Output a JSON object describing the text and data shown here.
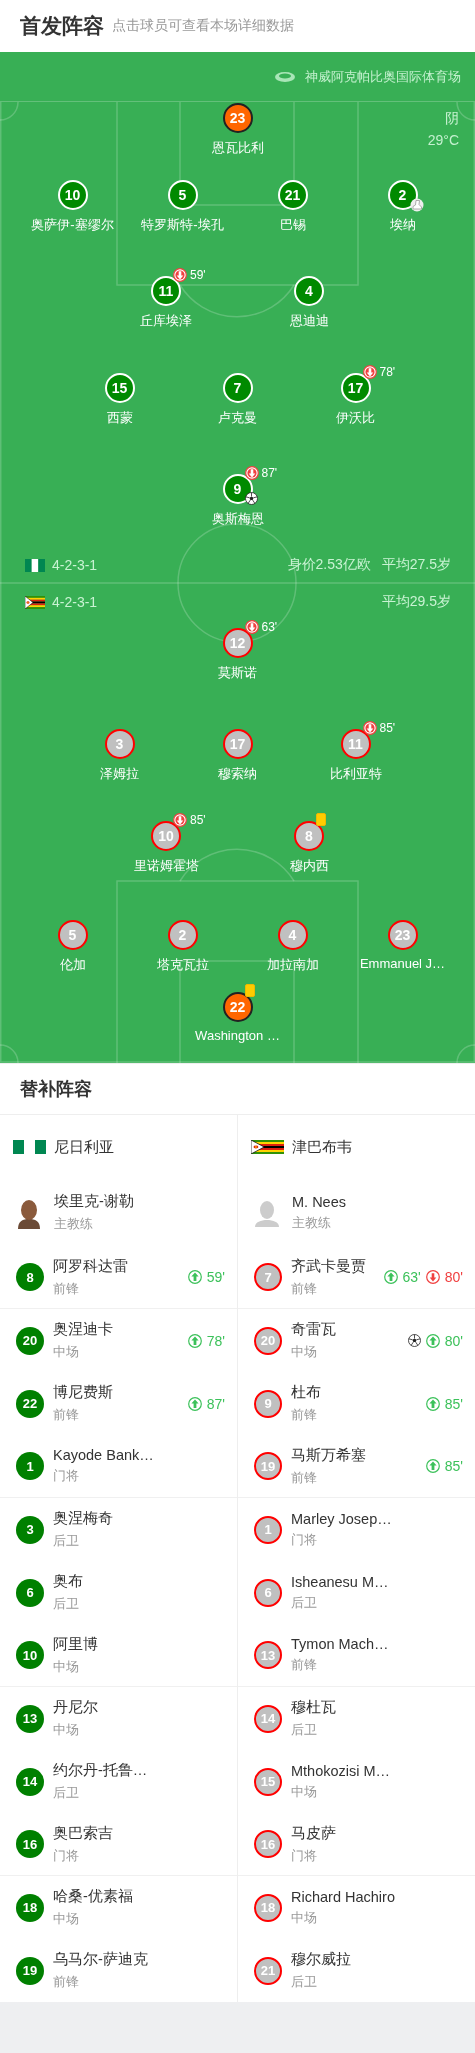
{
  "header": {
    "title": "首发阵容",
    "hint": "点击球员可查看本场详细数据"
  },
  "venue": {
    "stadium": "神威阿克帕比奥国际体育场",
    "weather": "阴",
    "temperature": "29°C"
  },
  "home": {
    "formation": "4-2-3-1",
    "value": "身价2.53亿欧",
    "average_age": "平均27.5岁",
    "lines": [
      [
        {
          "number": "23",
          "name": "恩瓦比利",
          "kind": "goalkeeper"
        }
      ],
      [
        {
          "number": "10",
          "name": "奥萨伊-塞缪尔",
          "kind": "outfield"
        },
        {
          "number": "5",
          "name": "特罗斯特-埃孔",
          "kind": "outfield"
        },
        {
          "number": "21",
          "name": "巴锡",
          "kind": "outfield"
        },
        {
          "number": "2",
          "name": "埃纳",
          "kind": "outfield",
          "events": [
            {
              "kind": "assist"
            }
          ]
        }
      ],
      [
        {
          "number": "11",
          "name": "丘库埃泽",
          "kind": "outfield",
          "events": [
            {
              "kind": "sub_off",
              "minute": "59'"
            }
          ]
        },
        {
          "number": "4",
          "name": "恩迪迪",
          "kind": "outfield"
        }
      ],
      [
        {
          "number": "15",
          "name": "西蒙",
          "kind": "outfield"
        },
        {
          "number": "7",
          "name": "卢克曼",
          "kind": "outfield"
        },
        {
          "number": "17",
          "name": "伊沃比",
          "kind": "outfield",
          "events": [
            {
              "kind": "sub_off",
              "minute": "78'"
            }
          ]
        }
      ],
      [
        {
          "number": "9",
          "name": "奥斯梅恩",
          "kind": "outfield",
          "events": [
            {
              "kind": "sub_off",
              "minute": "87'"
            },
            {
              "kind": "goal"
            }
          ]
        }
      ]
    ]
  },
  "away": {
    "formation": "4-2-3-1",
    "average_age": "平均29.5岁",
    "lines": [
      [
        {
          "number": "12",
          "name": "莫斯诺",
          "kind": "outfield",
          "events": [
            {
              "kind": "sub_off",
              "minute": "63'"
            }
          ]
        }
      ],
      [
        {
          "number": "3",
          "name": "泽姆拉",
          "kind": "outfield"
        },
        {
          "number": "17",
          "name": "穆索纳",
          "kind": "outfield"
        },
        {
          "number": "11",
          "name": "比利亚特",
          "kind": "outfield",
          "events": [
            {
              "kind": "sub_off",
              "minute": "85'"
            }
          ]
        }
      ],
      [
        {
          "number": "10",
          "name": "里诺姆霍塔",
          "kind": "outfield",
          "events": [
            {
              "kind": "sub_off",
              "minute": "85'"
            }
          ]
        },
        {
          "number": "8",
          "name": "穆内西",
          "kind": "outfield",
          "events": [
            {
              "kind": "yellow_card"
            }
          ]
        }
      ],
      [
        {
          "number": "5",
          "name": "伦加",
          "kind": "outfield"
        },
        {
          "number": "2",
          "name": "塔克瓦拉",
          "kind": "outfield"
        },
        {
          "number": "4",
          "name": "加拉南加",
          "kind": "outfield"
        },
        {
          "number": "23",
          "name": "Emmanuel J…",
          "kind": "outfield"
        }
      ],
      [
        {
          "number": "22",
          "name": "Washington …",
          "kind": "goalkeeper",
          "events": [
            {
              "kind": "yellow_card"
            }
          ]
        }
      ]
    ]
  },
  "subs": {
    "title": "替补阵容",
    "teams": [
      {
        "name": "尼日利亚",
        "coach": {
          "name": "埃里克-谢勒",
          "role": "主教练",
          "photo": true
        },
        "players": [
          {
            "number": "8",
            "name": "阿罗科达雷",
            "position": "前锋",
            "events": [
              {
                "kind": "sub_on",
                "minute": "59'"
              }
            ]
          },
          {
            "number": "20",
            "name": "奥涅迪卡",
            "position": "中场",
            "events": [
              {
                "kind": "sub_on",
                "minute": "78'"
              }
            ]
          },
          {
            "number": "22",
            "name": "博尼费斯",
            "position": "前锋",
            "events": [
              {
                "kind": "sub_on",
                "minute": "87'"
              }
            ]
          },
          {
            "number": "1",
            "name": "Kayode Bank…",
            "position": "门将"
          },
          {
            "number": "3",
            "name": "奥涅梅奇",
            "position": "后卫"
          },
          {
            "number": "6",
            "name": "奥布",
            "position": "后卫"
          },
          {
            "number": "10",
            "name": "阿里博",
            "position": "中场"
          },
          {
            "number": "13",
            "name": "丹尼尔",
            "position": "中场"
          },
          {
            "number": "14",
            "name": "约尔丹-托鲁…",
            "position": "后卫"
          },
          {
            "number": "16",
            "name": "奥巴索吉",
            "position": "门将"
          },
          {
            "number": "18",
            "name": "哈桑-优素福",
            "position": "中场"
          },
          {
            "number": "19",
            "name": "乌马尔-萨迪克",
            "position": "前锋"
          }
        ]
      },
      {
        "name": "津巴布韦",
        "coach": {
          "name": "M. Nees",
          "role": "主教练",
          "photo": false
        },
        "players": [
          {
            "number": "7",
            "name": "齐武卡曼贾",
            "position": "前锋",
            "events": [
              {
                "kind": "sub_on",
                "minute": "63'"
              },
              {
                "kind": "sub_off",
                "minute": "80'"
              }
            ]
          },
          {
            "number": "20",
            "name": "奇雷瓦",
            "position": "中场",
            "events": [
              {
                "kind": "goal"
              },
              {
                "kind": "sub_on",
                "minute": "80'"
              }
            ]
          },
          {
            "number": "9",
            "name": "杜布",
            "position": "前锋",
            "events": [
              {
                "kind": "sub_on",
                "minute": "85'"
              }
            ]
          },
          {
            "number": "19",
            "name": "马斯万希塞",
            "position": "前锋",
            "events": [
              {
                "kind": "sub_on",
                "minute": "85'"
              }
            ]
          },
          {
            "number": "1",
            "name": "Marley Josep…",
            "position": "门将"
          },
          {
            "number": "6",
            "name": "Isheanesu M…",
            "position": "后卫"
          },
          {
            "number": "13",
            "name": "Tymon Mach…",
            "position": "前锋"
          },
          {
            "number": "14",
            "name": "穆杜瓦",
            "position": "后卫"
          },
          {
            "number": "15",
            "name": "Mthokozisi M…",
            "position": "中场"
          },
          {
            "number": "16",
            "name": "马皮萨",
            "position": "门将"
          },
          {
            "number": "18",
            "name": "Richard Hachiro",
            "position": "中场"
          },
          {
            "number": "21",
            "name": "穆尔威拉",
            "position": "后卫"
          }
        ]
      }
    ]
  }
}
